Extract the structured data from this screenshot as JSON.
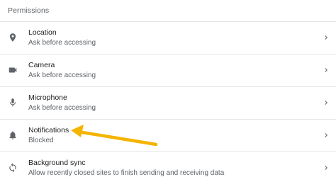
{
  "section": {
    "title": "Permissions"
  },
  "permissions": [
    {
      "label": "Location",
      "status": "Ask before accessing",
      "icon": "location-pin-icon"
    },
    {
      "label": "Camera",
      "status": "Ask before accessing",
      "icon": "camera-icon"
    },
    {
      "label": "Microphone",
      "status": "Ask before accessing",
      "icon": "microphone-icon"
    },
    {
      "label": "Notifications",
      "status": "Blocked",
      "icon": "bell-icon"
    },
    {
      "label": "Background sync",
      "status": "Allow recently closed sites to finish sending and receiving data",
      "icon": "sync-icon"
    }
  ],
  "colors": {
    "primary_text": "#202124",
    "secondary_text": "#5f6368",
    "divider": "#e4e4e4",
    "annotation_arrow": "#f4b400"
  }
}
